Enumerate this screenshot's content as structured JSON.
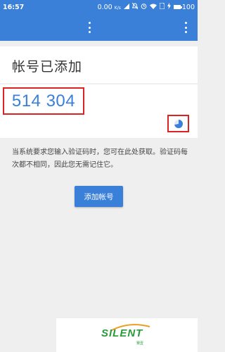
{
  "status_bar": {
    "time": "16:57",
    "network_speed": "0.00",
    "network_unit": "K/s",
    "battery_level": "100"
  },
  "header": {
    "title": "帐号已添加"
  },
  "code": {
    "value": "514 304"
  },
  "timer": {
    "remaining_fraction": 0.72
  },
  "info_text": "当系统要求您输入验证码时，您可在此处获取。验证码每次都不相同，因此您无需记住它。",
  "add_account_button": "添加帐号",
  "watermark": {
    "brand": "SILENT",
    "subtext": "赛壹"
  },
  "colors": {
    "primary": "#3a7fd8",
    "highlight_box": "#d22222",
    "watermark_green": "#2a9a3a"
  },
  "icons": [
    "signal-icon",
    "mute-icon",
    "alarm-icon",
    "wifi-icon",
    "sim-icon",
    "battery-icon",
    "overflow-menu-icon",
    "countdown-timer-icon"
  ]
}
